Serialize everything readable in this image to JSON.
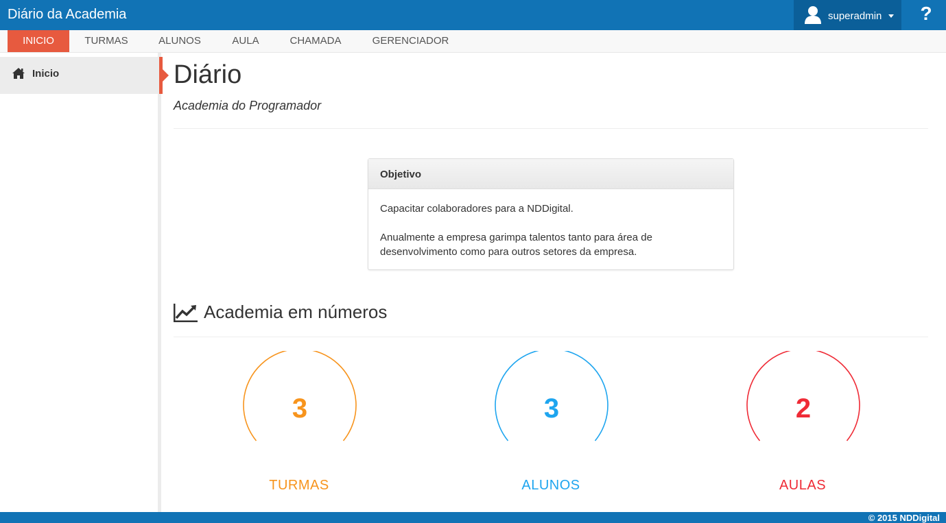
{
  "app": {
    "title": "Diário da Academia"
  },
  "user": {
    "name": "superadmin",
    "help": "?"
  },
  "nav": {
    "tabs": [
      {
        "label": "INICIO"
      },
      {
        "label": "TURMAS"
      },
      {
        "label": "ALUNOS"
      },
      {
        "label": "AULA"
      },
      {
        "label": "CHAMADA"
      },
      {
        "label": "GERENCIADOR"
      }
    ]
  },
  "sidebar": {
    "items": [
      {
        "label": "Inicio",
        "icon": "home-icon"
      }
    ]
  },
  "main": {
    "title": "Diário",
    "subtitle": "Academia do Programador",
    "panel": {
      "heading": "Objetivo",
      "paragraph1": "Capacitar colaboradores para a NDDigital.",
      "paragraph2": "Anualmente a empresa garimpa talentos tanto para área de desenvolvimento como para outros setores da empresa."
    },
    "stats_title": "Academia em números",
    "stats": [
      {
        "value": "3",
        "label": "TURMAS",
        "color": "#f7941d"
      },
      {
        "value": "3",
        "label": "ALUNOS",
        "color": "#1ea5ef"
      },
      {
        "value": "2",
        "label": "AULAS",
        "color": "#ef2b36"
      }
    ]
  },
  "footer": {
    "text": "© 2015 NDDigital"
  },
  "colors": {
    "brand": "#1173b5",
    "accent": "#e75a3f"
  }
}
